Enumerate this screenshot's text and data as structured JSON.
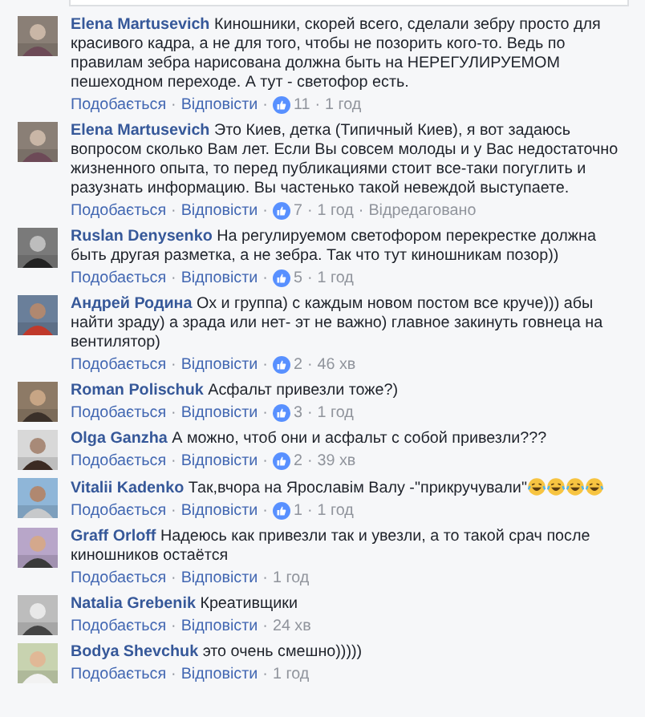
{
  "comments": [
    {
      "author": "Elena Martusevich",
      "text": "Киношники, скорей всего, сделали зебру просто для красивого кадра, а не для того, чтобы не позорить кого-то. Ведь по правилам зебра нарисована должна быть на НЕРЕГУЛИРУЕМОМ пешеходном переходе. А тут - светофор есть.",
      "actions": [
        {
          "kind": "like",
          "text": "Подобається"
        },
        {
          "kind": "separator",
          "text": "·"
        },
        {
          "kind": "reply",
          "text": "Відповісти"
        },
        {
          "kind": "separator",
          "text": "·"
        },
        {
          "kind": "likes",
          "text": "11"
        },
        {
          "kind": "separator",
          "text": "·"
        },
        {
          "kind": "meta",
          "text": "1 год"
        }
      ]
    },
    {
      "author": "Elena Martusevich",
      "text": "Это Киев, детка (Типичный Киев), я вот задаюсь вопросом сколько Вам лет. Если Вы совсем молоды и у Вас недостаточно жизненного опыта, то перед публикациями стоит все-таки погуглить и разузнать информацию. Вы частенько такой невеждой выступаете.",
      "actions": [
        {
          "kind": "like",
          "text": "Подобається"
        },
        {
          "kind": "separator",
          "text": "·"
        },
        {
          "kind": "reply",
          "text": "Відповісти"
        },
        {
          "kind": "separator",
          "text": "·"
        },
        {
          "kind": "likes",
          "text": "7"
        },
        {
          "kind": "separator",
          "text": "·"
        },
        {
          "kind": "meta",
          "text": "1 год"
        },
        {
          "kind": "separator",
          "text": "·"
        },
        {
          "kind": "meta",
          "text": "Відредаговано"
        }
      ]
    },
    {
      "author": "Ruslan Denysenko",
      "text": "На регулируемом светофором перекрестке должна быть другая разметка, а не зебра. Так что тут киношникам позор))",
      "actions": [
        {
          "kind": "like",
          "text": "Подобається"
        },
        {
          "kind": "separator",
          "text": "·"
        },
        {
          "kind": "reply",
          "text": "Відповісти"
        },
        {
          "kind": "separator",
          "text": "·"
        },
        {
          "kind": "likes",
          "text": "5"
        },
        {
          "kind": "separator",
          "text": "·"
        },
        {
          "kind": "meta",
          "text": "1 год"
        }
      ]
    },
    {
      "author": "Андрей Родина",
      "text": "Ох и группа) с каждым новом постом все круче))) абы найти зраду) а зрада или нет- эт не важно) главное закинуть говнеца на вентилятор)",
      "actions": [
        {
          "kind": "like",
          "text": "Подобається"
        },
        {
          "kind": "separator",
          "text": "·"
        },
        {
          "kind": "reply",
          "text": "Відповісти"
        },
        {
          "kind": "separator",
          "text": "·"
        },
        {
          "kind": "likes",
          "text": "2"
        },
        {
          "kind": "separator",
          "text": "·"
        },
        {
          "kind": "meta",
          "text": "46 хв"
        }
      ]
    },
    {
      "author": "Roman Polischuk",
      "text": "Асфальт привезли тоже?)",
      "actions": [
        {
          "kind": "like",
          "text": "Подобається"
        },
        {
          "kind": "separator",
          "text": "·"
        },
        {
          "kind": "reply",
          "text": "Відповісти"
        },
        {
          "kind": "separator",
          "text": "·"
        },
        {
          "kind": "likes",
          "text": "3"
        },
        {
          "kind": "separator",
          "text": "·"
        },
        {
          "kind": "meta",
          "text": "1 год"
        }
      ]
    },
    {
      "author": "Olga Ganzha",
      "text": "А можно, чтоб они и асфальт с собой привезли???",
      "actions": [
        {
          "kind": "like",
          "text": "Подобається"
        },
        {
          "kind": "separator",
          "text": "·"
        },
        {
          "kind": "reply",
          "text": "Відповісти"
        },
        {
          "kind": "separator",
          "text": "·"
        },
        {
          "kind": "likes",
          "text": "2"
        },
        {
          "kind": "separator",
          "text": "·"
        },
        {
          "kind": "meta",
          "text": "39 хв"
        }
      ]
    },
    {
      "author": "Vitalii Kadenko",
      "text": "Так,вчора на Ярославім Валу -\"прикручували\"",
      "laugh_icons": true,
      "actions": [
        {
          "kind": "like",
          "text": "Подобається"
        },
        {
          "kind": "separator",
          "text": "·"
        },
        {
          "kind": "reply",
          "text": "Відповісти"
        },
        {
          "kind": "separator",
          "text": "·"
        },
        {
          "kind": "likes",
          "text": "1"
        },
        {
          "kind": "separator",
          "text": "·"
        },
        {
          "kind": "meta",
          "text": "1 год"
        }
      ]
    },
    {
      "author": "Graff Orloff",
      "text": "Надеюсь как привезли так и увезли, а то такой срач после киношников остаётся",
      "actions": [
        {
          "kind": "like",
          "text": "Подобається"
        },
        {
          "kind": "separator",
          "text": "·"
        },
        {
          "kind": "reply",
          "text": "Відповісти"
        },
        {
          "kind": "separator",
          "text": "·"
        },
        {
          "kind": "meta",
          "text": "1 год"
        }
      ]
    },
    {
      "author": "Natalia Grebenik",
      "text": "Креативщики",
      "actions": [
        {
          "kind": "like",
          "text": "Подобається"
        },
        {
          "kind": "separator",
          "text": "·"
        },
        {
          "kind": "reply",
          "text": "Відповісти"
        },
        {
          "kind": "separator",
          "text": "·"
        },
        {
          "kind": "meta",
          "text": "24 хв"
        }
      ]
    },
    {
      "author": "Bodya Shevchuk",
      "text": "это очень смешно)))))",
      "actions": [
        {
          "kind": "like",
          "text": "Подобається"
        },
        {
          "kind": "separator",
          "text": "·"
        },
        {
          "kind": "reply",
          "text": "Відповісти"
        },
        {
          "kind": "separator",
          "text": "·"
        },
        {
          "kind": "meta",
          "text": "1 год"
        }
      ]
    }
  ]
}
